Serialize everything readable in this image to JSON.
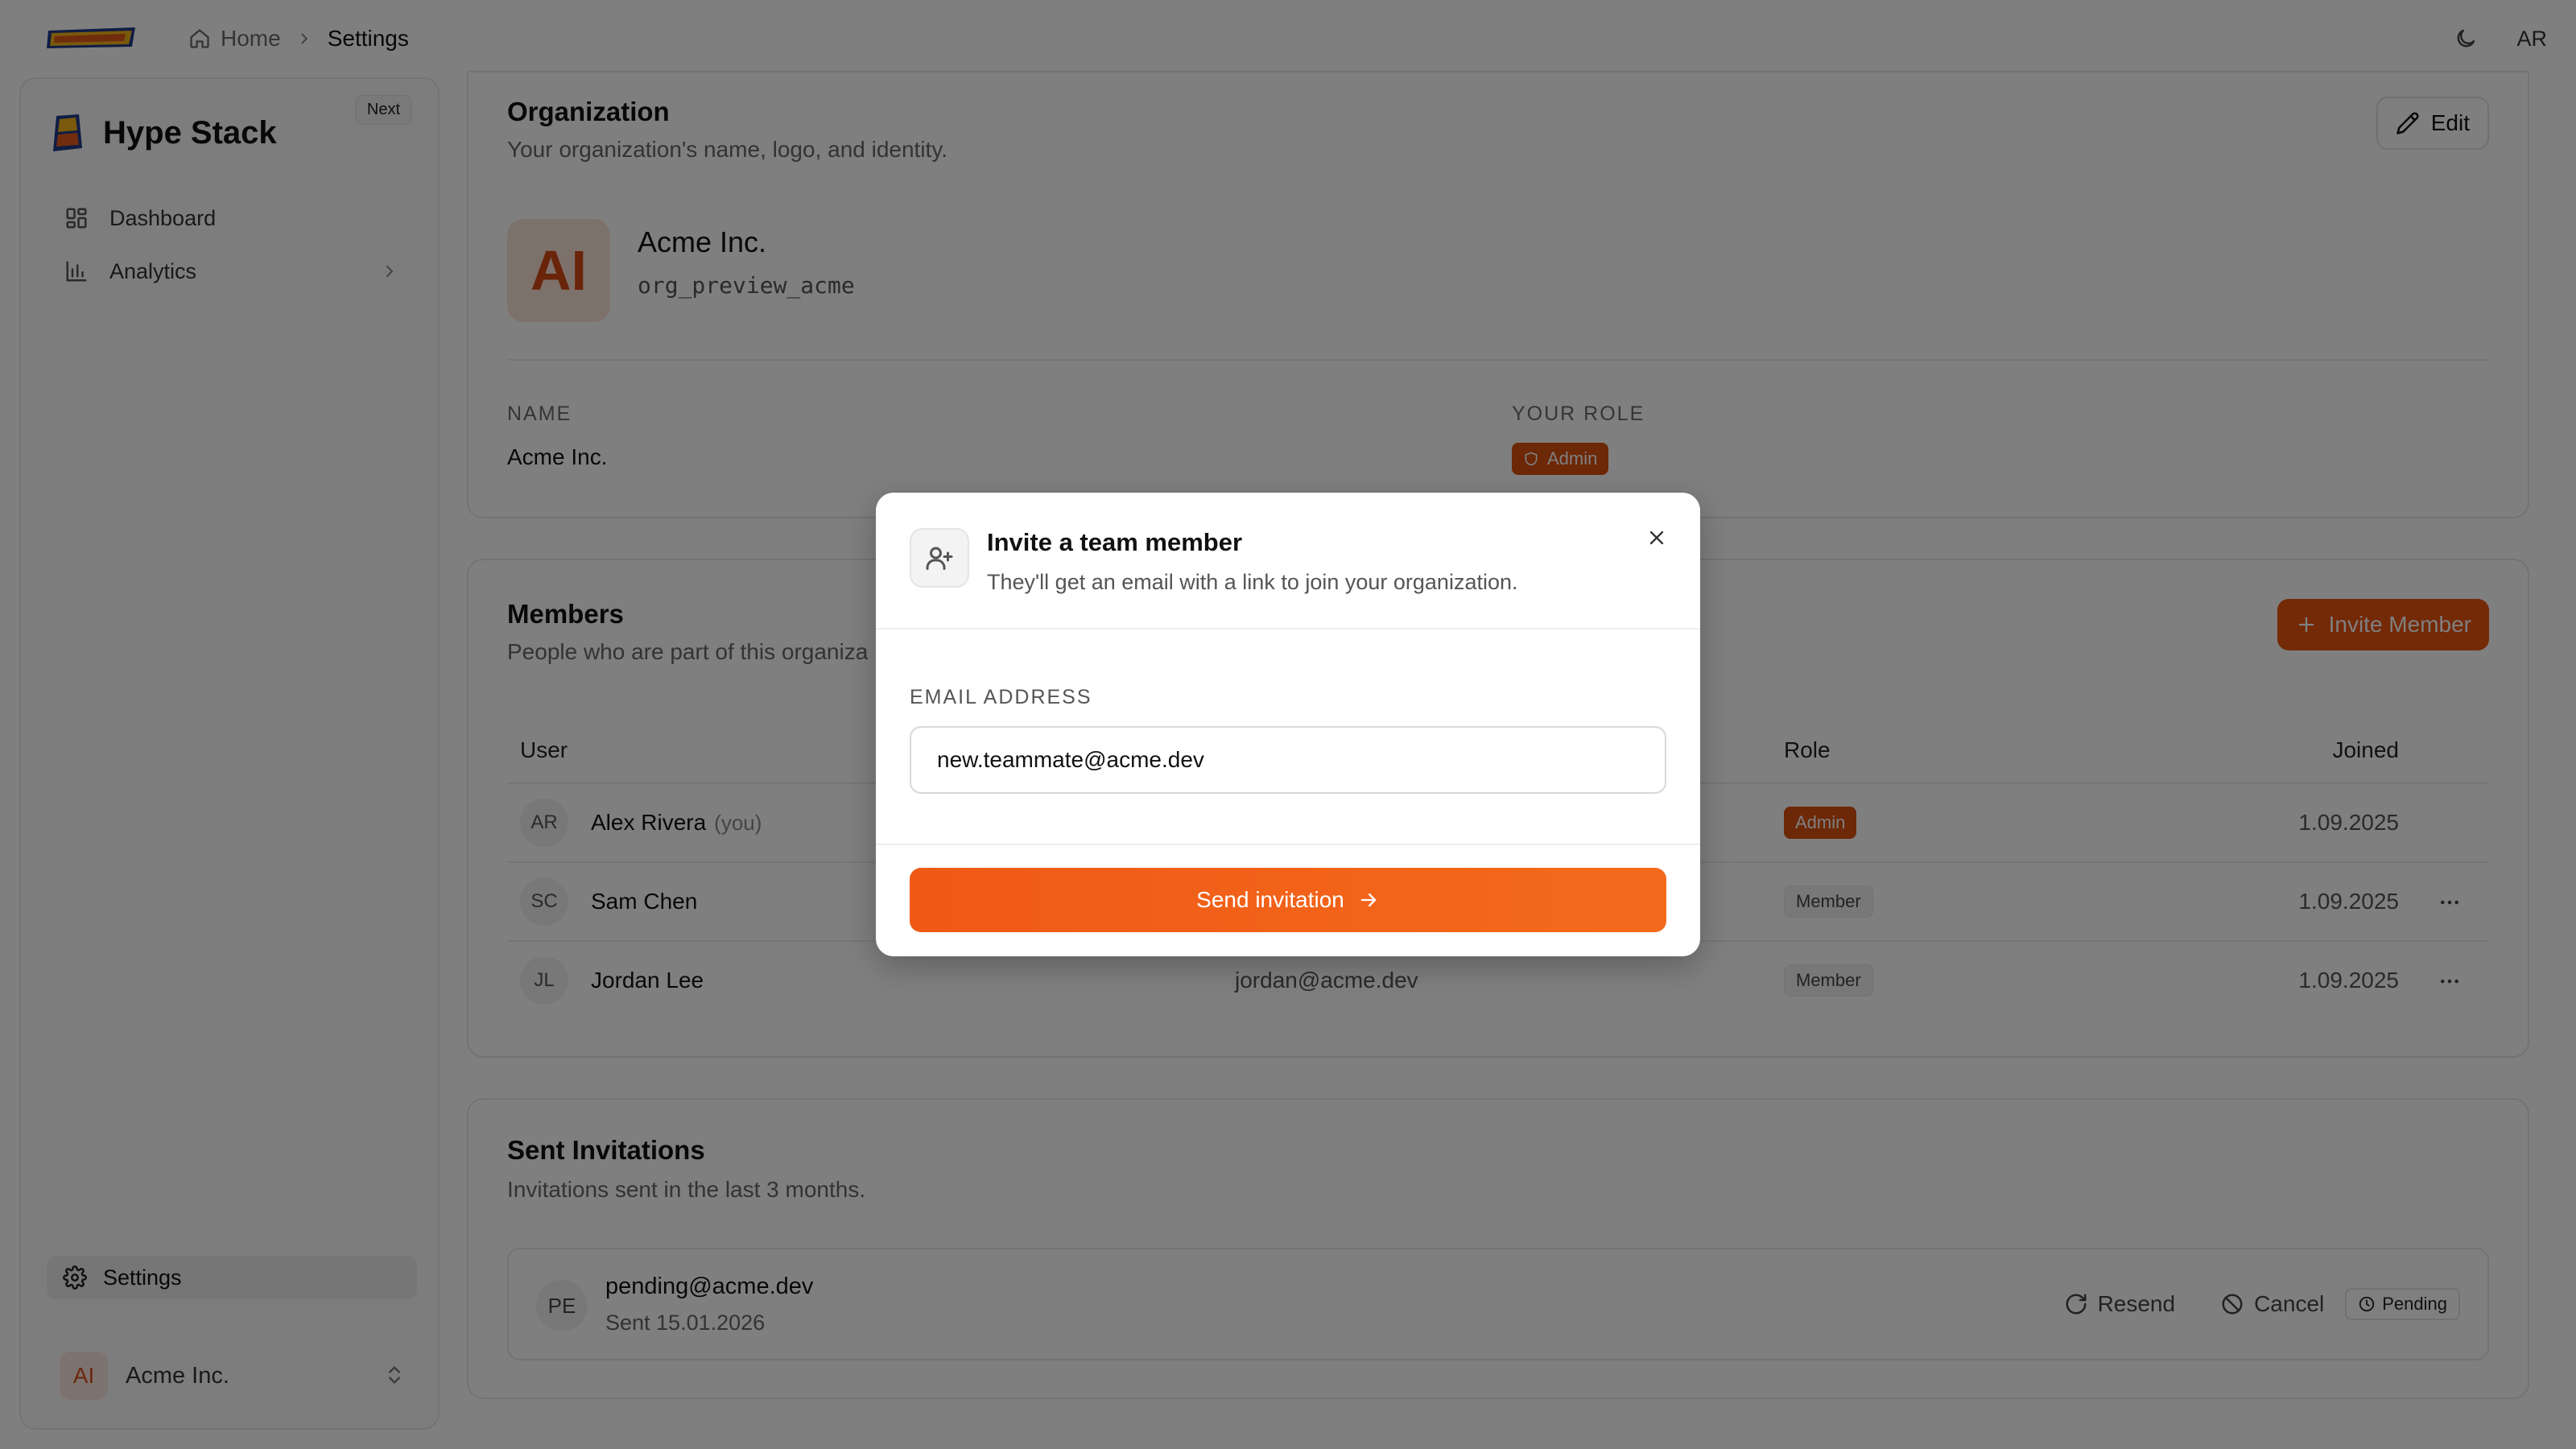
{
  "header": {
    "breadcrumb": {
      "home_label": "Home",
      "current_label": "Settings"
    },
    "user_initials": "AR"
  },
  "sidebar": {
    "brand_name": "Hype Stack",
    "badge": "Next",
    "items": [
      {
        "label": "Dashboard",
        "icon": "dashboard-icon"
      },
      {
        "label": "Analytics",
        "icon": "bar-chart-icon"
      }
    ],
    "settings_label": "Settings",
    "org_switcher": {
      "initials": "AI",
      "name": "Acme Inc."
    }
  },
  "organization": {
    "title": "Organization",
    "subtitle": "Your organization's name, logo, and identity.",
    "edit_label": "Edit",
    "avatar_initials": "AI",
    "name": "Acme Inc.",
    "slug": "org_preview_acme",
    "name_label": "NAME",
    "name_value": "Acme Inc.",
    "role_label": "YOUR ROLE",
    "role_value": "Admin"
  },
  "members": {
    "title": "Members",
    "subtitle": "People who are part of this organiza",
    "invite_label": "Invite Member",
    "columns": {
      "user": "User",
      "role": "Role",
      "joined": "Joined"
    },
    "rows": [
      {
        "initials": "AR",
        "name": "Alex Rivera",
        "you": "(you)",
        "email": "",
        "role": "Admin",
        "joined": "1.09.2025"
      },
      {
        "initials": "SC",
        "name": "Sam Chen",
        "email": "",
        "role": "Member",
        "joined": "1.09.2025"
      },
      {
        "initials": "JL",
        "name": "Jordan Lee",
        "email": "jordan@acme.dev",
        "role": "Member",
        "joined": "1.09.2025"
      }
    ]
  },
  "invitations": {
    "title": "Sent Invitations",
    "subtitle": "Invitations sent in the last 3 months.",
    "items": [
      {
        "initials": "PE",
        "email": "pending@acme.dev",
        "sent": "Sent 15.01.2026",
        "resend_label": "Resend",
        "cancel_label": "Cancel",
        "status": "Pending"
      }
    ]
  },
  "modal": {
    "title": "Invite a team member",
    "description": "They'll get an email with a link to join your organization.",
    "email_label": "EMAIL ADDRESS",
    "email_value": "new.teammate@acme.dev",
    "submit_label": "Send invitation"
  },
  "colors": {
    "accent": "#e8530e",
    "overlay": "rgba(0,0,0,0.5)"
  }
}
